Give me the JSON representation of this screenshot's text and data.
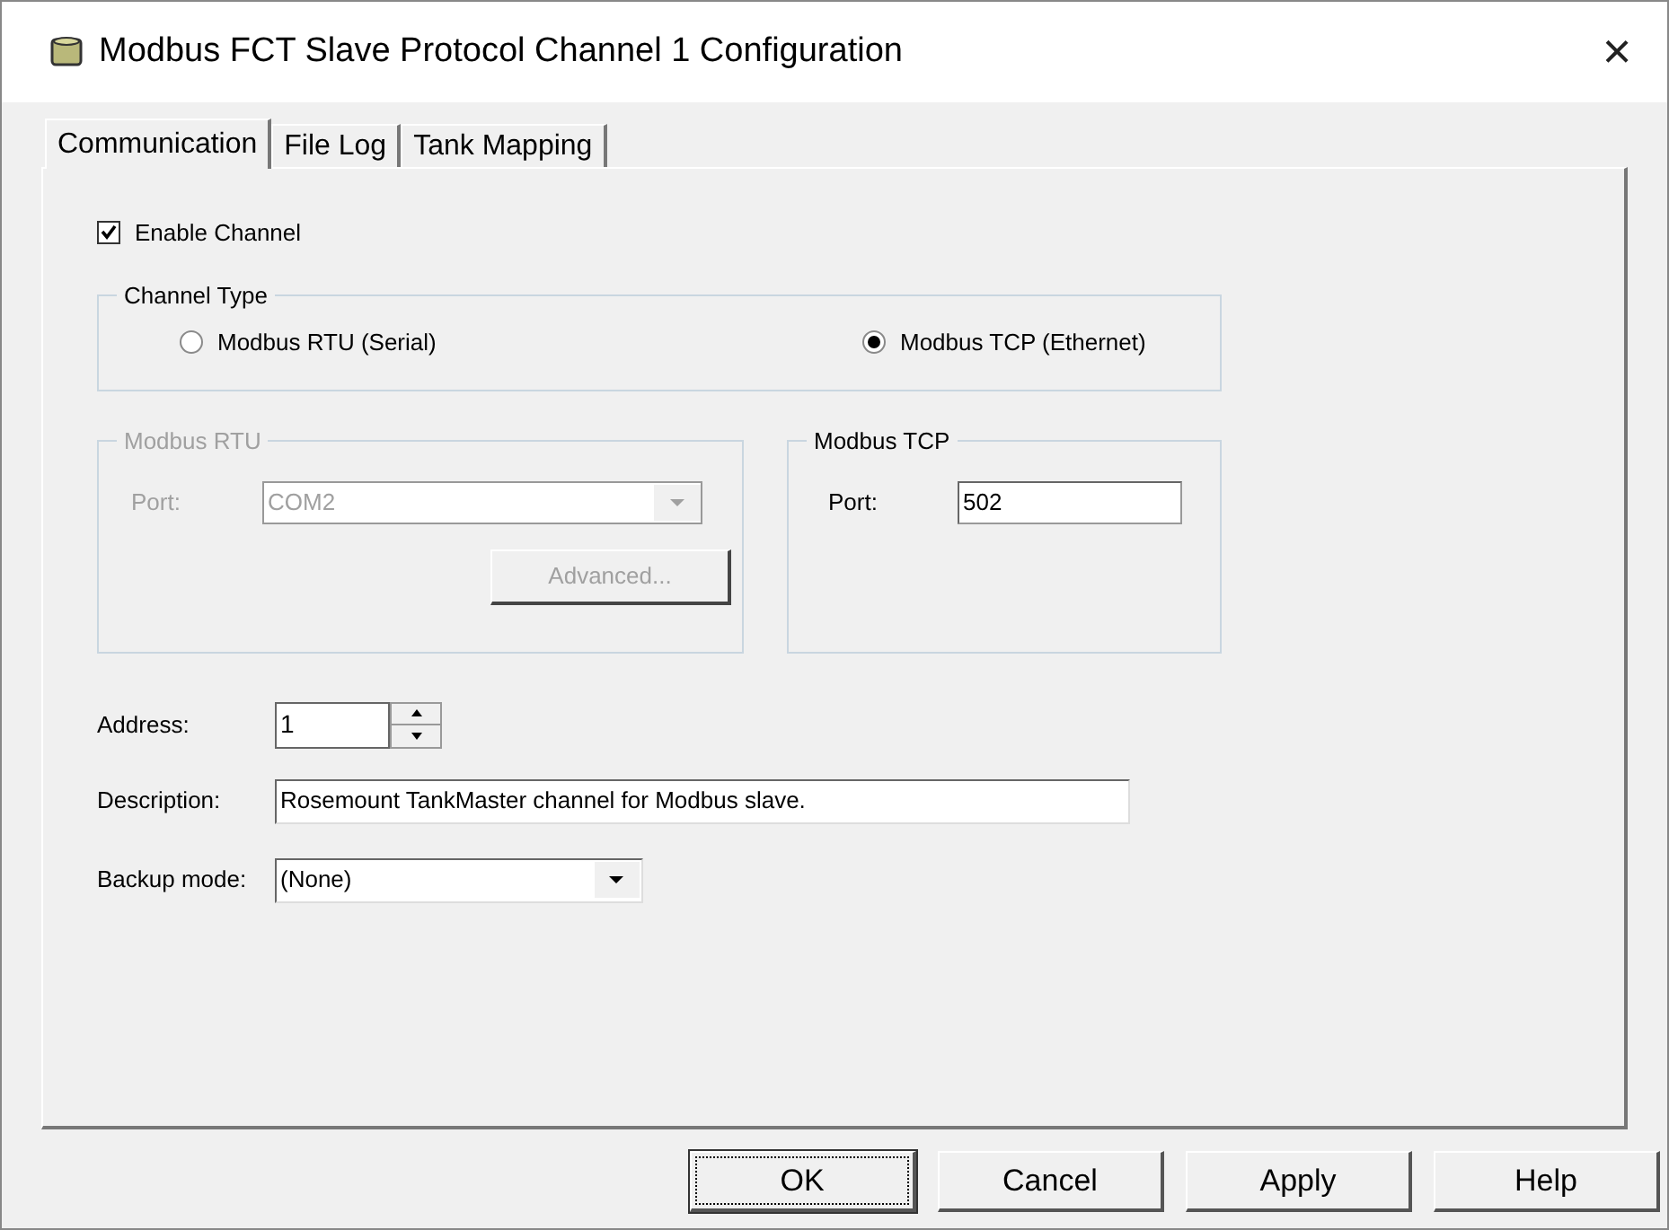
{
  "window": {
    "title": "Modbus FCT Slave Protocol Channel 1 Configuration",
    "close": "×"
  },
  "tabs": [
    {
      "label": "Communication",
      "selected": true
    },
    {
      "label": "File Log",
      "selected": false
    },
    {
      "label": "Tank Mapping",
      "selected": false
    }
  ],
  "enable_channel": {
    "label": "Enable Channel",
    "checked": true
  },
  "channel_type": {
    "title": "Channel Type",
    "options": [
      {
        "label": "Modbus RTU (Serial)",
        "selected": false
      },
      {
        "label": "Modbus TCP (Ethernet)",
        "selected": true
      }
    ]
  },
  "modbus_rtu": {
    "title": "Modbus RTU",
    "disabled": true,
    "port_label": "Port:",
    "port_value": "COM2",
    "advanced_button": "Advanced..."
  },
  "modbus_tcp": {
    "title": "Modbus TCP",
    "disabled": false,
    "port_label": "Port:",
    "port_value": "502"
  },
  "address": {
    "label": "Address:",
    "value": "1"
  },
  "description": {
    "label": "Description:",
    "value": "Rosemount TankMaster channel for Modbus slave."
  },
  "backup_mode": {
    "label": "Backup mode:",
    "value": "(None)"
  },
  "buttons": [
    {
      "label": "OK",
      "focused": true
    },
    {
      "label": "Cancel",
      "focused": false
    },
    {
      "label": "Apply",
      "focused": false
    },
    {
      "label": "Help",
      "focused": false
    }
  ]
}
